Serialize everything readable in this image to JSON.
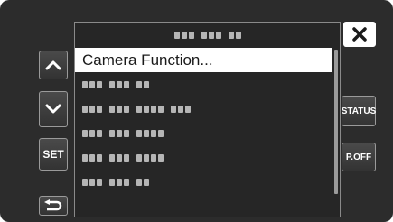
{
  "menu": {
    "title_obscured": true,
    "items": [
      {
        "label": "Camera Function...",
        "selected": true
      },
      {
        "label": null,
        "selected": false
      },
      {
        "label": null,
        "selected": false
      },
      {
        "label": null,
        "selected": false
      },
      {
        "label": null,
        "selected": false
      },
      {
        "label": null,
        "selected": false
      }
    ]
  },
  "left_buttons": {
    "up": {
      "icon": "chevron-up-icon"
    },
    "down": {
      "icon": "chevron-down-icon"
    },
    "set": {
      "label": "SET"
    },
    "back": {
      "icon": "return-arrow-icon"
    }
  },
  "right_buttons": {
    "close": {
      "icon": "close-icon"
    },
    "status": {
      "label": "STATUS"
    },
    "power_off": {
      "label": "P.OFF"
    }
  },
  "colors": {
    "background": "#2c2c2c",
    "panel_border": "#8a8a8a",
    "selected_row": "#ffffff",
    "text": "#ffffff"
  }
}
